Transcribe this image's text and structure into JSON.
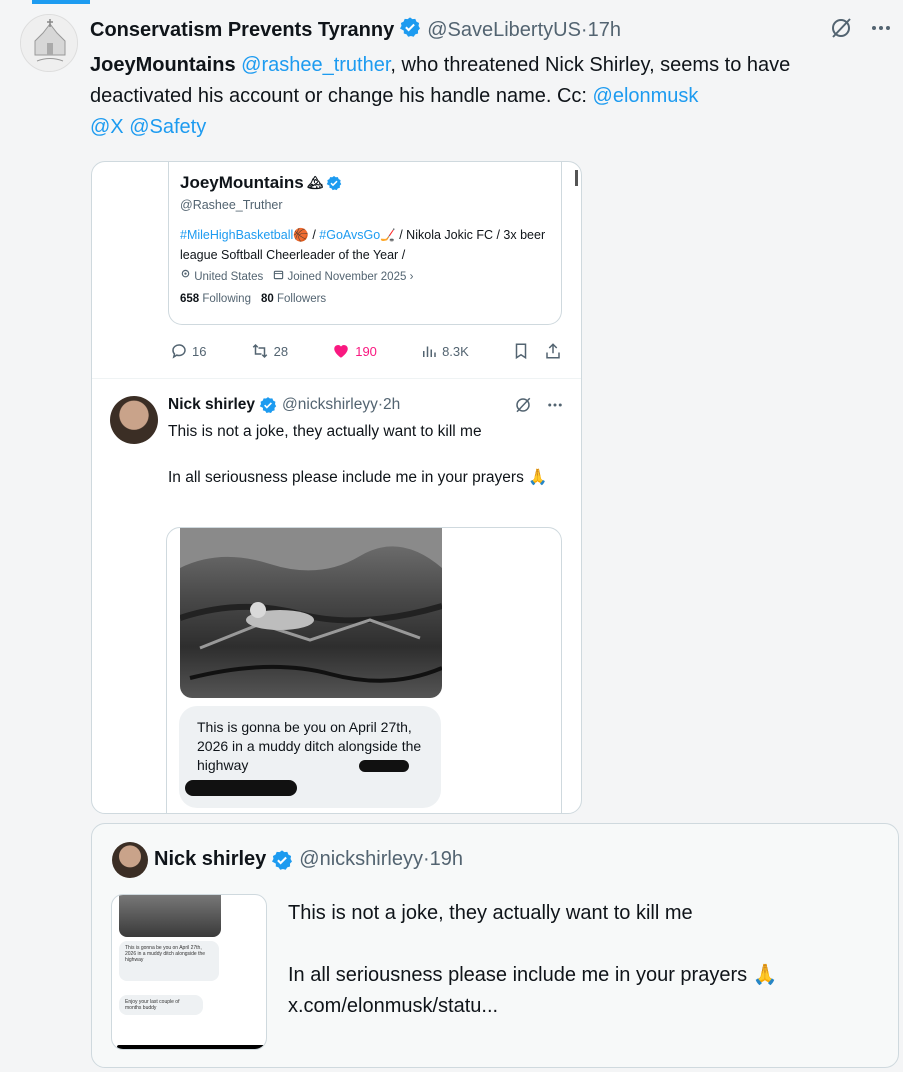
{
  "main_tweet": {
    "author_name": "Conservatism Prevents Tyranny",
    "handle": "@SaveLibertyUS",
    "time_sep": " · ",
    "time": "17h",
    "text_lead": "JoeyMountains",
    "mention_1": "@rashee_truther",
    "text_mid": ", who threatened Nick Shirley, seems to have deactivated his account or change his handle name.  Cc: ",
    "mention_2": "@elonmusk",
    "mention_3": "@X",
    "mention_4": "@Safety"
  },
  "profile_card": {
    "name": "JoeyMountains",
    "name_emoji": "🏔",
    "handle": "@Rashee_Truther",
    "bio_tag_1": "#MileHighBasketball",
    "bio_emoji_1": "🏀",
    "bio_sep_1": " / ",
    "bio_tag_2": "#GoAvsGo",
    "bio_emoji_2": "🏒",
    "bio_rest": " / Nikola Jokic FC / 3x beer league Softball Cheerleader of the Year /",
    "location": "United States",
    "joined": "Joined November 2025",
    "following_count": "658",
    "following_label": "Following",
    "followers_count": "80",
    "followers_label": "Followers"
  },
  "engagement": {
    "replies": "16",
    "reposts": "28",
    "likes": "190",
    "views": "8.3K"
  },
  "reply_tweet": {
    "author_name": "Nick shirley",
    "handle": "@nickshirleyy",
    "time_sep": " · ",
    "time": "2h",
    "line_1": "This is not a joke, they actually want to kill me",
    "line_2": "In all seriousness please include me in your prayers",
    "pray_emoji": "🙏",
    "bubble_text": "This is gonna be you on April 27th, 2026 in a  muddy ditch alongside the highway"
  },
  "quoted_tweet": {
    "author_name": "Nick shirley",
    "handle": "@nickshirleyy",
    "time_sep": " · ",
    "time": "19h",
    "line_1": "This is not a joke, they actually want to kill me",
    "line_2": "In all seriousness please include me in your prayers",
    "pray_emoji": "🙏",
    "link": "x.com/elonmusk/statu...",
    "thumb_bubble_1": "This is gonna be you on April 27th, 2026 in a  muddy ditch alongside the highway",
    "thumb_bubble_2": "Enjoy your last couple of months buddy"
  },
  "colors": {
    "accent": "#1d9bf0",
    "like": "#f91880",
    "muted": "#536471"
  }
}
